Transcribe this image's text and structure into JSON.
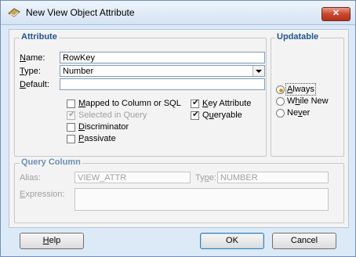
{
  "window": {
    "title": "New View Object Attribute",
    "close_icon": "close-icon"
  },
  "attribute": {
    "legend": "Attribute",
    "name_label": "Name:",
    "name_value": "RowKey",
    "type_label": "Type:",
    "type_value": "Number",
    "default_label": "Default:",
    "default_value": ""
  },
  "options": {
    "mapped": {
      "label": "Mapped to Column or SQL",
      "checked": false,
      "enabled": true
    },
    "selected_in_query": {
      "label": "Selected in Query",
      "checked": true,
      "enabled": false
    },
    "discriminator": {
      "label": "Discriminator",
      "checked": false,
      "enabled": true
    },
    "passivate": {
      "label": "Passivate",
      "checked": false,
      "enabled": true
    },
    "key_attribute": {
      "label": "Key Attribute",
      "checked": true,
      "enabled": true
    },
    "queryable": {
      "label": "Queryable",
      "checked": true,
      "enabled": true
    }
  },
  "updatable": {
    "legend": "Updatable",
    "options": [
      "Always",
      "While New",
      "Never"
    ],
    "selected": "Always"
  },
  "query_column": {
    "legend": "Query Column",
    "alias_label": "Alias:",
    "alias_value": "VIEW_ATTR",
    "type_label": "Type:",
    "type_value": "NUMBER",
    "expression_label": "Expression:",
    "expression_value": ""
  },
  "buttons": {
    "help": "Help",
    "ok": "OK",
    "cancel": "Cancel"
  },
  "colors": {
    "legend_text": "#21558f",
    "close_button": "#c9472c",
    "dialog_background": "#dce9f7"
  }
}
